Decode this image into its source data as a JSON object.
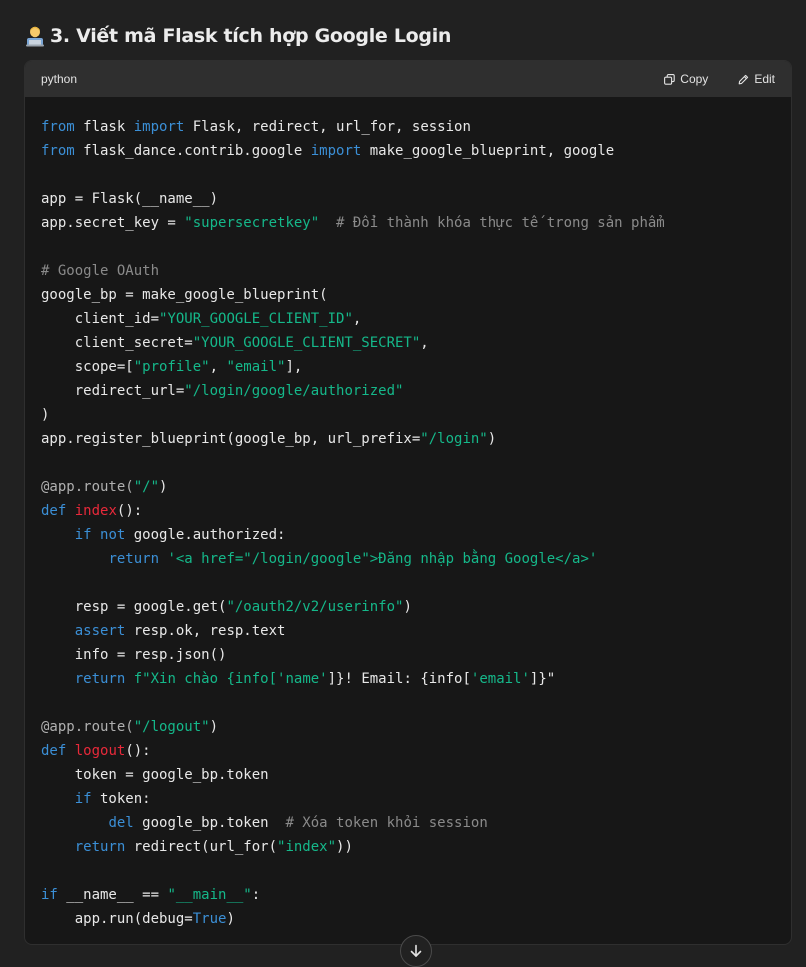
{
  "heading": {
    "icon": "technologist-emoji-icon",
    "text": "3. Viết mã Flask tích hợp Google Login"
  },
  "code_block": {
    "language": "python",
    "copy_label": "Copy",
    "edit_label": "Edit",
    "colors": {
      "keyword": "#3b8fd6",
      "string": "#15b88a",
      "comment": "#8a8a8a",
      "function_name": "#e8293a",
      "text": "#e8e8e8"
    },
    "lines": [
      [
        {
          "t": "from",
          "c": "kw"
        },
        {
          "t": " flask "
        },
        {
          "t": "import",
          "c": "kw"
        },
        {
          "t": " Flask, redirect, url_for, session"
        }
      ],
      [
        {
          "t": "from",
          "c": "kw"
        },
        {
          "t": " flask_dance.contrib.google "
        },
        {
          "t": "import",
          "c": "kw"
        },
        {
          "t": " make_google_blueprint, google"
        }
      ],
      [],
      [
        {
          "t": "app = Flask(__name__)"
        }
      ],
      [
        {
          "t": "app.secret_key = "
        },
        {
          "t": "\"supersecretkey\"",
          "c": "str"
        },
        {
          "t": "  "
        },
        {
          "t": "# Đổi thành khóa thực tế trong sản phẩm",
          "c": "cm"
        }
      ],
      [],
      [
        {
          "t": "# Google OAuth",
          "c": "cm"
        }
      ],
      [
        {
          "t": "google_bp = make_google_blueprint("
        }
      ],
      [
        {
          "t": "    client_id="
        },
        {
          "t": "\"YOUR_GOOGLE_CLIENT_ID\"",
          "c": "str"
        },
        {
          "t": ","
        }
      ],
      [
        {
          "t": "    client_secret="
        },
        {
          "t": "\"YOUR_GOOGLE_CLIENT_SECRET\"",
          "c": "str"
        },
        {
          "t": ","
        }
      ],
      [
        {
          "t": "    scope=["
        },
        {
          "t": "\"profile\"",
          "c": "str"
        },
        {
          "t": ", "
        },
        {
          "t": "\"email\"",
          "c": "str"
        },
        {
          "t": "],"
        }
      ],
      [
        {
          "t": "    redirect_url="
        },
        {
          "t": "\"/login/google/authorized\"",
          "c": "str"
        }
      ],
      [
        {
          "t": ")"
        }
      ],
      [
        {
          "t": "app.register_blueprint(google_bp, url_prefix="
        },
        {
          "t": "\"/login\"",
          "c": "str"
        },
        {
          "t": ")"
        }
      ],
      [],
      [
        {
          "t": "@app.route(",
          "c": "dec"
        },
        {
          "t": "\"/\"",
          "c": "str"
        },
        {
          "t": ")"
        }
      ],
      [
        {
          "t": "def",
          "c": "kw"
        },
        {
          "t": " "
        },
        {
          "t": "index",
          "c": "fn"
        },
        {
          "t": "():"
        }
      ],
      [
        {
          "t": "    "
        },
        {
          "t": "if",
          "c": "kw"
        },
        {
          "t": " "
        },
        {
          "t": "not",
          "c": "kw"
        },
        {
          "t": " google.authorized:"
        }
      ],
      [
        {
          "t": "        "
        },
        {
          "t": "return",
          "c": "kw"
        },
        {
          "t": " "
        },
        {
          "t": "'<a href=\"/login/google\">Đăng nhập bằng Google</a>'",
          "c": "str"
        }
      ],
      [],
      [
        {
          "t": "    resp = google.get("
        },
        {
          "t": "\"/oauth2/v2/userinfo\"",
          "c": "str"
        },
        {
          "t": ")"
        }
      ],
      [
        {
          "t": "    "
        },
        {
          "t": "assert",
          "c": "kw"
        },
        {
          "t": " resp.ok, resp.text"
        }
      ],
      [
        {
          "t": "    info = resp.json()"
        }
      ],
      [
        {
          "t": "    "
        },
        {
          "t": "return",
          "c": "kw"
        },
        {
          "t": " "
        },
        {
          "t": "f\"Xin chào {info[",
          "c": "str"
        },
        {
          "t": "'name'",
          "c": "str"
        },
        {
          "t": "]}! Email: {info["
        },
        {
          "t": "'email'",
          "c": "str"
        },
        {
          "t": "]}\""
        }
      ],
      [],
      [
        {
          "t": "@app.route(",
          "c": "dec"
        },
        {
          "t": "\"/logout\"",
          "c": "str"
        },
        {
          "t": ")"
        }
      ],
      [
        {
          "t": "def",
          "c": "kw"
        },
        {
          "t": " "
        },
        {
          "t": "logout",
          "c": "fn"
        },
        {
          "t": "():"
        }
      ],
      [
        {
          "t": "    token = google_bp.token"
        }
      ],
      [
        {
          "t": "    "
        },
        {
          "t": "if",
          "c": "kw"
        },
        {
          "t": " token:"
        }
      ],
      [
        {
          "t": "        "
        },
        {
          "t": "del",
          "c": "kw"
        },
        {
          "t": " google_bp.token  "
        },
        {
          "t": "# Xóa token khỏi session",
          "c": "cm"
        }
      ],
      [
        {
          "t": "    "
        },
        {
          "t": "return",
          "c": "kw"
        },
        {
          "t": " redirect(url_for("
        },
        {
          "t": "\"index\"",
          "c": "str"
        },
        {
          "t": "))"
        }
      ],
      [],
      [
        {
          "t": "if",
          "c": "kw"
        },
        {
          "t": " __name__ == "
        },
        {
          "t": "\"__main__\"",
          "c": "str"
        },
        {
          "t": ":"
        }
      ],
      [
        {
          "t": "    app.run(debug="
        },
        {
          "t": "True",
          "c": "kw"
        },
        {
          "t": ")"
        }
      ]
    ]
  },
  "scroll_button": {
    "icon": "arrow-down-icon"
  }
}
